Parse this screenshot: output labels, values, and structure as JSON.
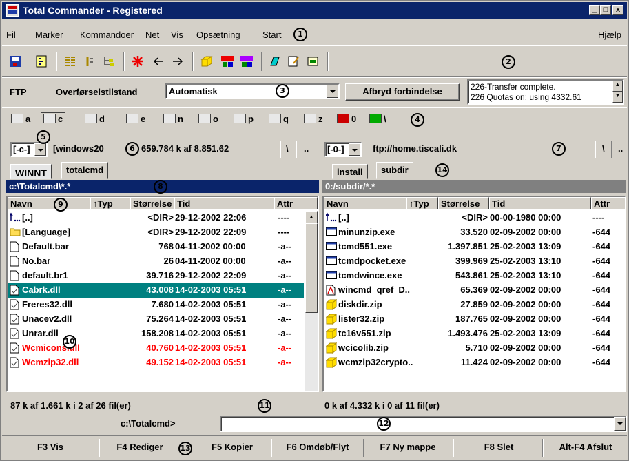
{
  "window": {
    "title": "Total Commander - Registered",
    "controls": [
      "_",
      "□",
      "x"
    ]
  },
  "menu": {
    "items": [
      "Fil",
      "Marker",
      "Kommandoer",
      "Net",
      "Vis",
      "Opsætning",
      "Start"
    ],
    "help": "Hjælp"
  },
  "callouts": [
    "1",
    "2",
    "3",
    "4",
    "5",
    "6",
    "7",
    "8",
    "9",
    "10",
    "11",
    "12",
    "13",
    "14"
  ],
  "ftp": {
    "label": "FTP",
    "mode_label": "Overførselstilstand",
    "mode_value": "Automatisk",
    "disconnect_button": "Afbryd forbindelse",
    "log_lines": [
      "226-Transfer complete.",
      "226 Quotas on: using 4332.61"
    ]
  },
  "drives": [
    "a",
    "c",
    "d",
    "e",
    "n",
    "o",
    "p",
    "q",
    "z",
    "0",
    "\\"
  ],
  "left": {
    "drive_select": "[-c-]",
    "volume_info": "[windows20",
    "free_info": "659.784 k af 8.851.62",
    "root_btn": "\\",
    "up_btn": "..",
    "tabs": [
      "WINNT",
      "totalcmd"
    ],
    "path": "c:\\Totalcmd\\*.*",
    "columns": [
      "Navn",
      "↑Typ",
      "Størrelse",
      "Tid",
      "Attr"
    ],
    "files": [
      {
        "name": "[..]",
        "size": "<DIR>",
        "time": "29-12-2002 22:06",
        "attr": "----",
        "kind": "up"
      },
      {
        "name": "[Language]",
        "size": "<DIR>",
        "time": "29-12-2002 22:09",
        "attr": "----",
        "kind": "folder"
      },
      {
        "name": "Default.bar",
        "size": "768",
        "time": "04-11-2002 00:00",
        "attr": "-a--",
        "kind": "file"
      },
      {
        "name": "No.bar",
        "size": "26",
        "time": "04-11-2002 00:00",
        "attr": "-a--",
        "kind": "file"
      },
      {
        "name": "default.br1",
        "size": "39.716",
        "time": "29-12-2002 22:09",
        "attr": "-a--",
        "kind": "file"
      },
      {
        "name": "Cabrk.dll",
        "size": "43.008",
        "time": "14-02-2003 05:51",
        "attr": "-a--",
        "kind": "dll",
        "selected": true
      },
      {
        "name": "Freres32.dll",
        "size": "7.680",
        "time": "14-02-2003 05:51",
        "attr": "-a--",
        "kind": "dll"
      },
      {
        "name": "Unacev2.dll",
        "size": "75.264",
        "time": "14-02-2003 05:51",
        "attr": "-a--",
        "kind": "dll"
      },
      {
        "name": "Unrar.dll",
        "size": "158.208",
        "time": "14-02-2003 05:51",
        "attr": "-a--",
        "kind": "dll"
      },
      {
        "name": "Wcmicons.dll",
        "size": "40.760",
        "time": "14-02-2003 05:51",
        "attr": "-a--",
        "kind": "dll",
        "marked": true
      },
      {
        "name": "Wcmzip32.dll",
        "size": "49.152",
        "time": "14-02-2003 05:51",
        "attr": "-a--",
        "kind": "dll",
        "marked": true
      }
    ],
    "status": "87 k af 1.661 k i 2 af 26 fil(er)"
  },
  "right": {
    "drive_select": "[-0-]",
    "location": "ftp://home.tiscali.dk",
    "root_btn": "\\",
    "up_btn": "..",
    "tabs": [
      "install",
      "subdir"
    ],
    "path": "0:/subdir/*.*",
    "columns": [
      "Navn",
      "↑Typ",
      "Størrelse",
      "Tid",
      "Attr"
    ],
    "files": [
      {
        "name": "[..]",
        "size": "<DIR>",
        "time": "00-00-1980 00:00",
        "attr": "----",
        "kind": "up"
      },
      {
        "name": "minunzip.exe",
        "size": "33.520",
        "time": "02-09-2002 00:00",
        "attr": "-644",
        "kind": "exe"
      },
      {
        "name": "tcmd551.exe",
        "size": "1.397.851",
        "time": "25-02-2003 13:09",
        "attr": "-644",
        "kind": "exe"
      },
      {
        "name": "tcmdpocket.exe",
        "size": "399.969",
        "time": "25-02-2003 13:10",
        "attr": "-644",
        "kind": "exe"
      },
      {
        "name": "tcmdwince.exe",
        "size": "543.861",
        "time": "25-02-2003 13:10",
        "attr": "-644",
        "kind": "exe"
      },
      {
        "name": "wincmd_qref_D..",
        "size": "65.369",
        "time": "02-09-2002 00:00",
        "attr": "-644",
        "kind": "pdf"
      },
      {
        "name": "diskdir.zip",
        "size": "27.859",
        "time": "02-09-2002 00:00",
        "attr": "-644",
        "kind": "zip"
      },
      {
        "name": "lister32.zip",
        "size": "187.765",
        "time": "02-09-2002 00:00",
        "attr": "-644",
        "kind": "zip"
      },
      {
        "name": "tc16v551.zip",
        "size": "1.493.476",
        "time": "25-02-2003 13:09",
        "attr": "-644",
        "kind": "zip"
      },
      {
        "name": "wcicolib.zip",
        "size": "5.710",
        "time": "02-09-2002 00:00",
        "attr": "-644",
        "kind": "zip"
      },
      {
        "name": "wcmzip32crypto..",
        "size": "11.424",
        "time": "02-09-2002 00:00",
        "attr": "-644",
        "kind": "zip"
      }
    ],
    "status": "0 k af 4.332 k i 0 af 11 fil(er)"
  },
  "cmdline": {
    "path": "c:\\Totalcmd>",
    "value": ""
  },
  "fkeys": [
    "F3 Vis",
    "F4 Rediger",
    "F5 Kopier",
    "F6 Omdøb/Flyt",
    "F7 Ny mappe",
    "F8 Slet",
    "Alt-F4 Afslut"
  ],
  "colors": {
    "titlebar": "#0a246a",
    "inactive_header": "#808080",
    "selection": "#008080",
    "marked_text": "#ff0000",
    "face": "#d4d0c8"
  }
}
